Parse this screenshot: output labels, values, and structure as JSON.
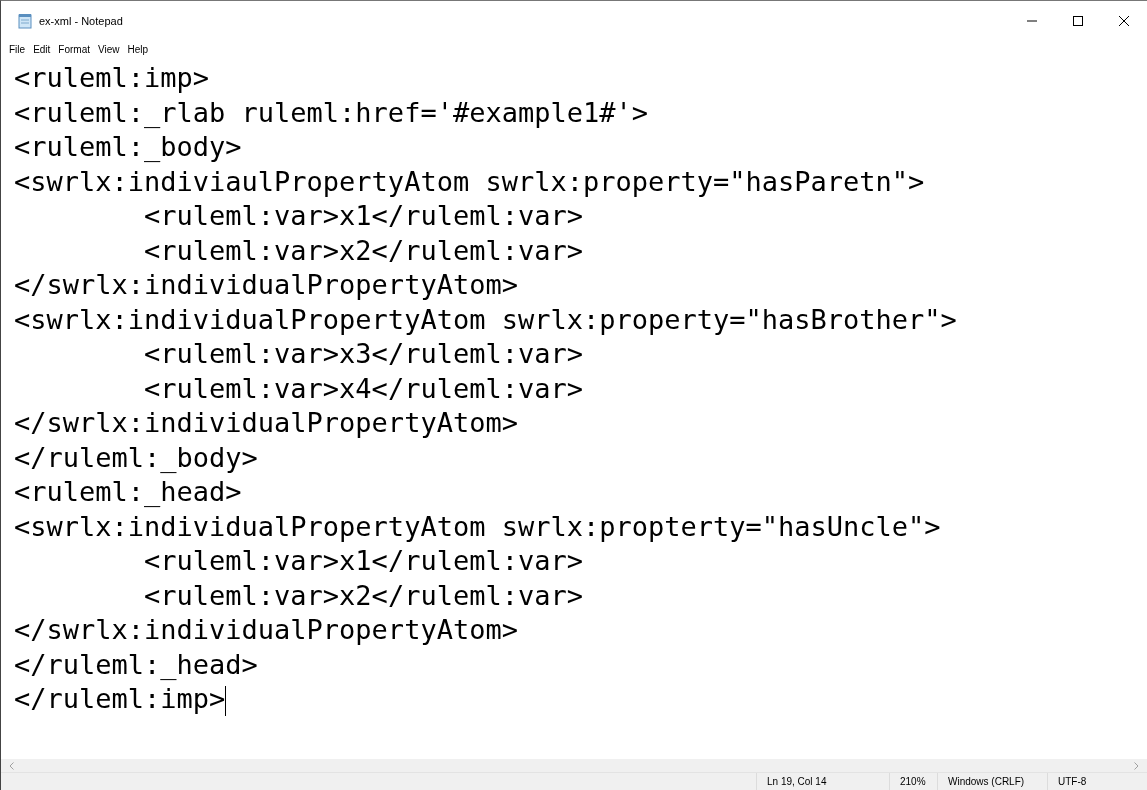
{
  "window": {
    "title": "ex-xml - Notepad"
  },
  "menu": [
    "File",
    "Edit",
    "Format",
    "View",
    "Help"
  ],
  "editor": {
    "lines": [
      "<ruleml:imp>",
      "<ruleml:_rlab ruleml:href='#example1#'>",
      "<ruleml:_body>",
      "<swrlx:indiviaulPropertyAtom swrlx:property=\"hasParetn\">",
      "\t<ruleml:var>x1</ruleml:var>",
      "\t<ruleml:var>x2</ruleml:var>",
      "</swrlx:individualPropertyAtom>",
      "<swrlx:individualPropertyAtom swrlx:property=\"hasBrother\">",
      "\t<ruleml:var>x3</ruleml:var>",
      "\t<ruleml:var>x4</ruleml:var>",
      "</swrlx:individualPropertyAtom>",
      "</ruleml:_body>",
      "<ruleml:_head>",
      "<swrlx:individualPropertyAtom swrlx:propterty=\"hasUncle\">",
      "\t<ruleml:var>x1</ruleml:var>",
      "\t<ruleml:var>x2</ruleml:var>",
      "</swrlx:individualPropertyAtom>",
      "</ruleml:_head>",
      "</ruleml:imp>"
    ]
  },
  "status_bar": {
    "position": "Ln 19, Col 14",
    "zoom": "210%",
    "line_ending": "Windows (CRLF)",
    "encoding": "UTF-8"
  }
}
